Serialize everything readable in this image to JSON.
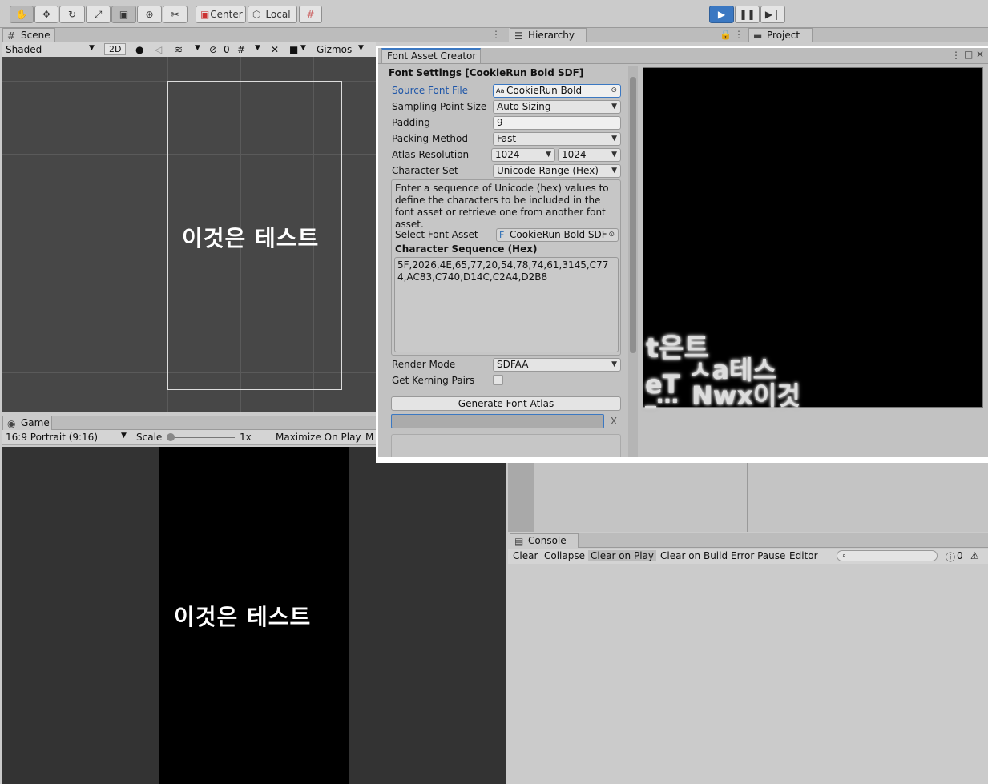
{
  "toolbar": {
    "center_label": "Center",
    "local_label": "Local"
  },
  "scene": {
    "tab_label": "Scene",
    "shading": "Shaded",
    "mode_2d": "2D",
    "hidden_count": "0",
    "gizmos": "Gizmos",
    "sample_text": "이것은 테스트"
  },
  "game": {
    "tab_label": "Game",
    "aspect": "16:9 Portrait (9:16)",
    "scale_label": "Scale",
    "scale_value": "1x",
    "maximize": "Maximize On Play",
    "more": "M",
    "sample_text": "이것은 테스트"
  },
  "hierarchy": {
    "tab_label": "Hierarchy"
  },
  "project": {
    "tab_label": "Project"
  },
  "console": {
    "tab_label": "Console",
    "clear": "Clear",
    "collapse": "Collapse",
    "clear_on_play": "Clear on Play",
    "clear_on_build": "Clear on Build",
    "error_pause": "Error Pause",
    "editor": "Editor",
    "error_count": "0"
  },
  "fac": {
    "title": "Font Asset Creator",
    "heading": "Font Settings [CookieRun Bold SDF]",
    "source_font_label": "Source Font File",
    "source_font_value": "CookieRun Bold",
    "sampling_label": "Sampling Point Size",
    "sampling_value": "Auto Sizing",
    "padding_label": "Padding",
    "padding_value": "9",
    "packing_label": "Packing Method",
    "packing_value": "Fast",
    "atlas_res_label": "Atlas Resolution",
    "atlas_w": "1024",
    "atlas_h": "1024",
    "charset_label": "Character Set",
    "charset_value": "Unicode Range (Hex)",
    "help_text": "Enter a sequence of Unicode (hex) values to define the characters to be included in the font asset or retrieve one from another font asset.",
    "select_asset_label": "Select Font Asset",
    "select_asset_value": "CookieRun Bold SDF",
    "sequence_label": "Character Sequence (Hex)",
    "sequence_value": "5F,2026,4E,65,77,20,54,78,74,61,3145,C774,AC83,C740,D14C,C2A4,D2B8",
    "render_mode_label": "Render Mode",
    "render_mode_value": "SDFAA",
    "kerning_label": "Get Kerning Pairs",
    "generate_label": "Generate Font Atlas",
    "cancel_label": "X",
    "atlas_glyphs_row1": "t은트",
    "atlas_glyphs_row2": "ㅅa테스",
    "atlas_glyphs_row3a": "eT",
    "atlas_glyphs_row3b": "Nwx이것",
    "atlas_glyphs_row4": "_…"
  }
}
